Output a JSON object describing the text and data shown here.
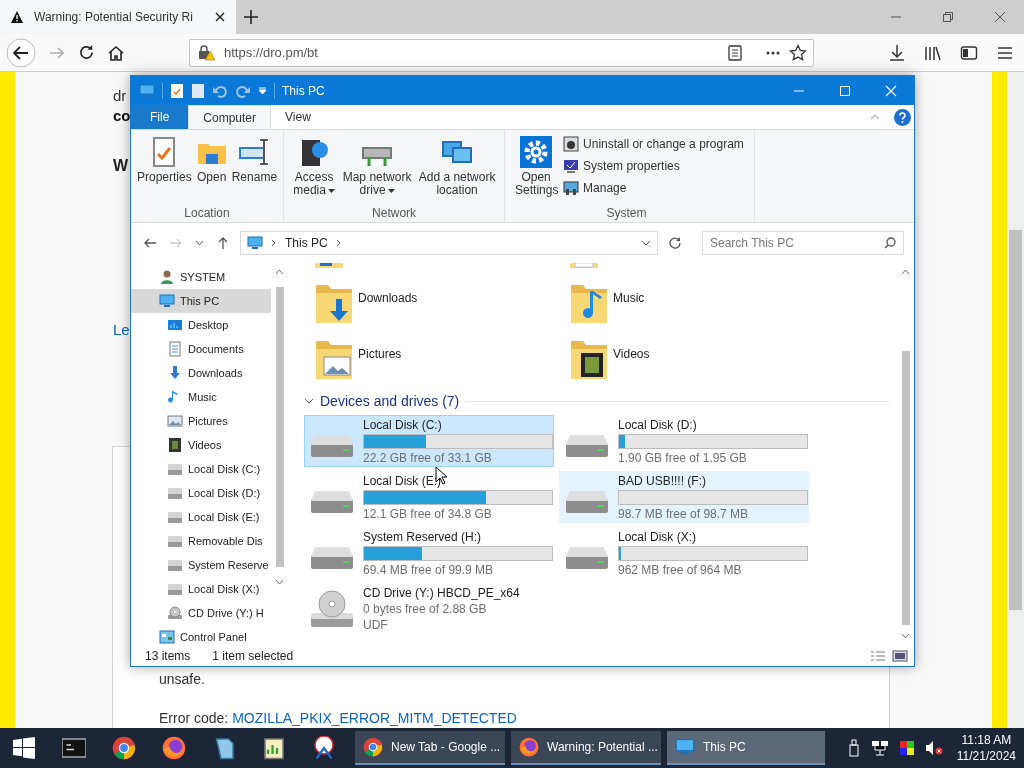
{
  "browser": {
    "tab": {
      "title": "Warning: Potential Security Ri",
      "selected": true
    },
    "url": "https://dro.pm/bt"
  },
  "page": {
    "fragments": [
      {
        "kind": "plain",
        "text": "dr"
      },
      {
        "kind": "bold",
        "text": "co"
      },
      {
        "kind": "heading",
        "text": "W"
      },
      {
        "kind": "link",
        "text": "Le"
      }
    ],
    "card": {
      "last_line": "unsafe.",
      "error_label": "Error code:",
      "error_code": "MOZILLA_PKIX_ERROR_MITM_DETECTED"
    }
  },
  "explorer": {
    "title": "This PC",
    "ribbon_tabs": [
      {
        "kind": "file",
        "label": "File",
        "selected": false
      },
      {
        "kind": "tab",
        "label": "Computer",
        "selected": true
      },
      {
        "kind": "tab",
        "label": "View",
        "selected": false
      }
    ],
    "ribbon_groups": [
      {
        "name": "Location",
        "buttons": [
          {
            "kind": "properties",
            "label": "Properties",
            "dropdown": false
          },
          {
            "kind": "open",
            "label": "Open",
            "dropdown": false
          },
          {
            "kind": "rename",
            "label": "Rename",
            "dropdown": false
          }
        ]
      },
      {
        "name": "Network",
        "buttons": [
          {
            "kind": "media",
            "label": "Access media",
            "dropdown": true
          },
          {
            "kind": "mapdrive",
            "label": "Map network drive",
            "dropdown": true
          },
          {
            "kind": "netloc",
            "label": "Add a network location",
            "dropdown": false
          }
        ]
      },
      {
        "name": "System",
        "buttons": [
          {
            "kind": "settings",
            "label": "Open Settings",
            "dropdown": false
          }
        ],
        "links": [
          {
            "kind": "uninstall",
            "label": "Uninstall or change a program"
          },
          {
            "kind": "sysprops",
            "label": "System properties"
          },
          {
            "kind": "manage",
            "label": "Manage"
          }
        ]
      }
    ],
    "address": {
      "location": "This PC"
    },
    "search": {
      "placeholder": "Search This PC"
    },
    "nav": [
      {
        "kind": "user",
        "label": "SYSTEM",
        "selected": false
      },
      {
        "kind": "pc",
        "label": "This PC",
        "selected": true,
        "children": [
          {
            "kind": "desktop",
            "label": "Desktop",
            "selected": false
          },
          {
            "kind": "documents",
            "label": "Documents",
            "selected": false
          },
          {
            "kind": "downloads",
            "label": "Downloads",
            "selected": false
          },
          {
            "kind": "music",
            "label": "Music",
            "selected": false
          },
          {
            "kind": "pictures",
            "label": "Pictures",
            "selected": false
          },
          {
            "kind": "videos",
            "label": "Videos",
            "selected": false
          },
          {
            "kind": "drive",
            "label": "Local Disk (C:)",
            "selected": false
          },
          {
            "kind": "drive",
            "label": "Local Disk (D:)",
            "selected": false
          },
          {
            "kind": "drive",
            "label": "Local Disk (E:)",
            "selected": false
          },
          {
            "kind": "drive",
            "label": "Removable Dis",
            "selected": false
          },
          {
            "kind": "drive",
            "label": "System Reserve",
            "selected": false
          },
          {
            "kind": "drive",
            "label": "Local Disk (X:)",
            "selected": false
          },
          {
            "kind": "cd",
            "label": "CD Drive (Y:) H",
            "selected": false
          }
        ]
      },
      {
        "kind": "control",
        "label": "Control Panel",
        "selected": false
      }
    ],
    "folders": [
      {
        "kind": "downloads",
        "label": "Downloads"
      },
      {
        "kind": "music",
        "label": "Music"
      },
      {
        "kind": "pictures",
        "label": "Pictures"
      },
      {
        "kind": "videos",
        "label": "Videos"
      }
    ],
    "drives": {
      "header": "Devices and drives (7)",
      "expanded": true,
      "items": [
        {
          "kind": "drive",
          "name": "Local Disk (C:)",
          "level": 0.33,
          "free": "22.2 GB free of 33.1 GB",
          "selected": true,
          "hovered": false
        },
        {
          "kind": "drive",
          "name": "Local Disk (D:)",
          "level": 0.03,
          "free": "1.90 GB free of 1.95 GB",
          "selected": false,
          "hovered": false
        },
        {
          "kind": "drive",
          "name": "Local Disk (E:)",
          "level": 0.65,
          "free": "12.1 GB free of 34.8 GB",
          "selected": false,
          "hovered": false
        },
        {
          "kind": "drive",
          "name": "BAD USB!!!! (F:)",
          "free": "98.7 MB free of 98.7 MB",
          "selected": false,
          "hovered": true
        },
        {
          "kind": "drive",
          "name": "System Reserved (H:)",
          "level": 0.31,
          "free": "69.4 MB free of 99.9 MB",
          "selected": false,
          "hovered": false
        },
        {
          "kind": "drive",
          "name": "Local Disk (X:)",
          "level": 0.01,
          "free": "962 MB free of 964 MB",
          "selected": false,
          "hovered": false
        },
        {
          "kind": "cd",
          "name": "CD Drive (Y:) HBCD_PE_x64",
          "free": "0 bytes free of 2.88 GB",
          "fs": "UDF",
          "selected": false,
          "hovered": false
        }
      ]
    },
    "status": {
      "count": "13 items",
      "selection": "1 item selected"
    }
  },
  "taskbar": {
    "pinned": [
      {
        "kind": "terminal"
      },
      {
        "kind": "chrome"
      },
      {
        "kind": "firefox"
      },
      {
        "kind": "notepad"
      },
      {
        "kind": "editor"
      },
      {
        "kind": "tool"
      }
    ],
    "apps": [
      {
        "kind": "chrome",
        "label": "New Tab - Google ...",
        "selected": false
      },
      {
        "kind": "firefox",
        "label": "Warning: Potential ...",
        "selected": false
      },
      {
        "kind": "explorer",
        "label": "This PC",
        "selected": true
      }
    ],
    "clock": {
      "time": "11:18 AM",
      "date": "11/21/2024"
    }
  }
}
